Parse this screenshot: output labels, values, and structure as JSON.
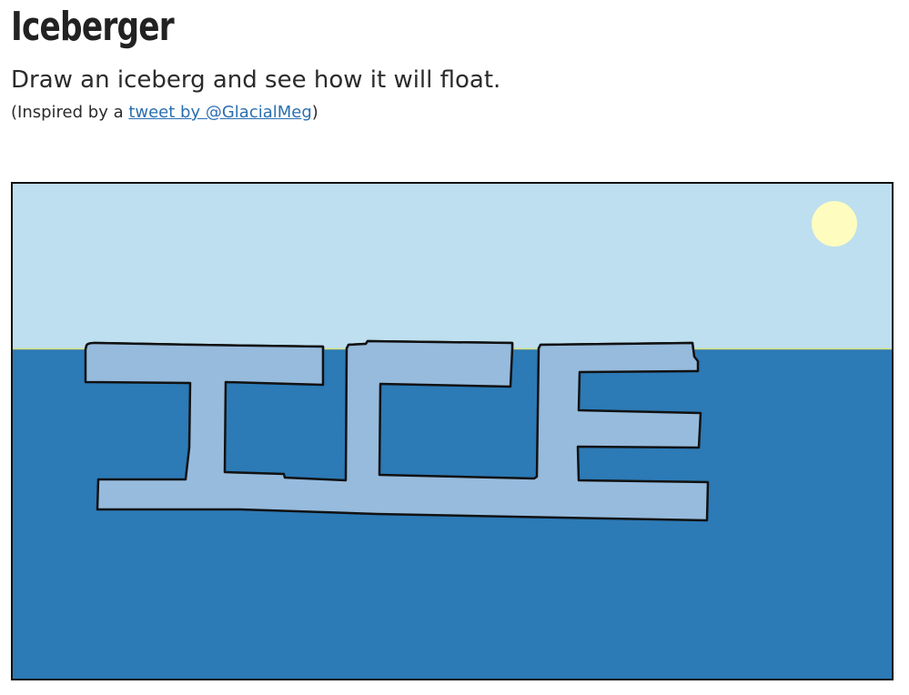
{
  "header": {
    "title": "Iceberger",
    "subtitle": "Draw an iceberg and see how it will float.",
    "credit_prefix": "(Inspired by a ",
    "credit_link": "tweet by @GlacialMeg",
    "credit_suffix": ")"
  },
  "scene": {
    "colors": {
      "sky": "#bddfef",
      "water": "#2c7ab6",
      "waterline": "#d8e37a",
      "iceberg_underwater": "#96bbdd",
      "iceberg_above": "#ffffff",
      "outline": "#111111",
      "sun": "#fffcc0"
    }
  }
}
